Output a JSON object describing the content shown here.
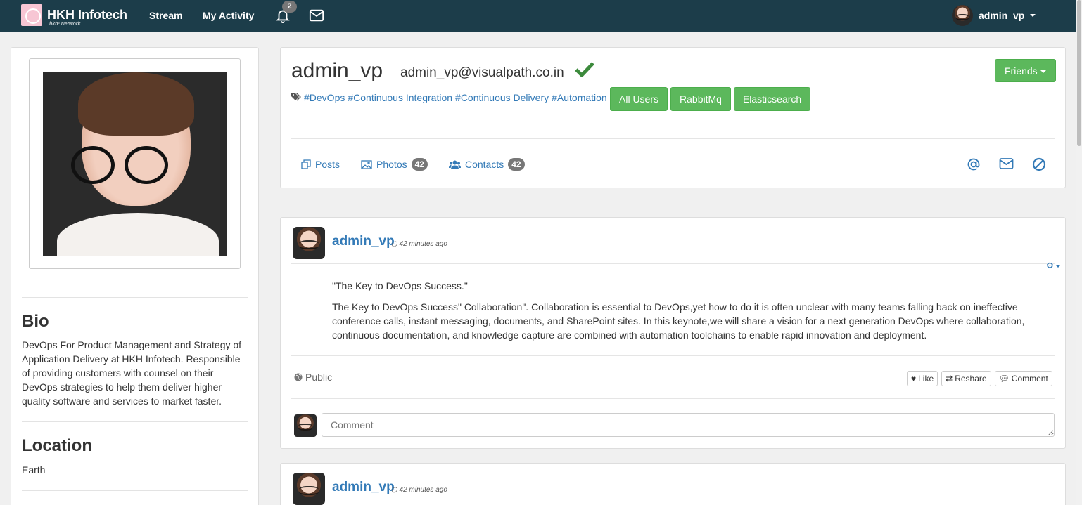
{
  "nav": {
    "brand_title": "HKH Infotech",
    "brand_sub": "hkh² Network",
    "stream": "Stream",
    "my_activity": "My Activity",
    "notification_count": "2",
    "username": "admin_vp"
  },
  "sidebar": {
    "bio_title": "Bio",
    "bio_text": "DevOps For Product Management and Strategy of Application Delivery at HKH Infotech. Responsible of providing customers with counsel on their DevOps strategies to help them deliver higher quality software and services to market faster.",
    "location_title": "Location",
    "location_text": "Earth"
  },
  "profile": {
    "username": "admin_vp",
    "email": "admin_vp@visualpath.co.in",
    "tags": [
      "#DevOps",
      "#Continuous Integration",
      "#Continuous Delivery",
      "#Automation"
    ],
    "groups": [
      "All Users",
      "RabbitMq",
      "Elasticsearch"
    ],
    "friends_button": "Friends",
    "tabs": {
      "posts": "Posts",
      "photos": "Photos",
      "photos_count": "42",
      "contacts": "Contacts",
      "contacts_count": "42"
    }
  },
  "posts": [
    {
      "author": "admin_vp",
      "time": "42 minutes ago",
      "title": "\"The Key to DevOps Success.\"",
      "body": "The Key to DevOps Success\" Collaboration\". Collaboration is essential to DevOps,yet how to do it is often unclear with many teams falling back on ineffective conference calls, instant messaging, documents, and SharePoint sites. In this keynote,we will share a vision for a next generation DevOps where collaboration, continuous documentation, and knowledge capture are combined with automation toolchains to enable rapid innovation and deployment.",
      "visibility": "Public",
      "like": "Like",
      "reshare": "Reshare",
      "comment": "Comment",
      "comment_placeholder": "Comment"
    },
    {
      "author": "admin_vp",
      "time": "42 minutes ago"
    }
  ],
  "colors": {
    "navbar": "#1c3d4a",
    "link": "#337ab7",
    "success": "#5cb85c",
    "verified": "#3c8a3c"
  }
}
